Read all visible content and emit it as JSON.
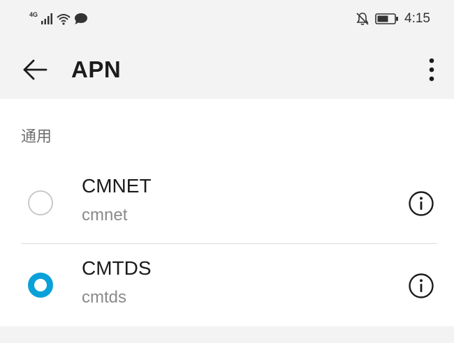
{
  "status_bar": {
    "network_type": "4G",
    "time": "4:15",
    "icons": [
      "signal-icon",
      "wifi-icon",
      "message-icon",
      "bell-off-icon",
      "battery-icon"
    ]
  },
  "app_bar": {
    "title": "APN",
    "back_icon": "arrow-left-icon",
    "more_icon": "more-vertical-icon"
  },
  "section": {
    "header": "通用"
  },
  "apns": [
    {
      "name": "CMNET",
      "subtitle": "cmnet",
      "selected": false
    },
    {
      "name": "CMTDS",
      "subtitle": "cmtds",
      "selected": true
    }
  ],
  "colors": {
    "accent": "#0aa1d9",
    "background": "#f3f3f3",
    "surface": "#ffffff",
    "secondary_text": "#8a8a8a"
  }
}
